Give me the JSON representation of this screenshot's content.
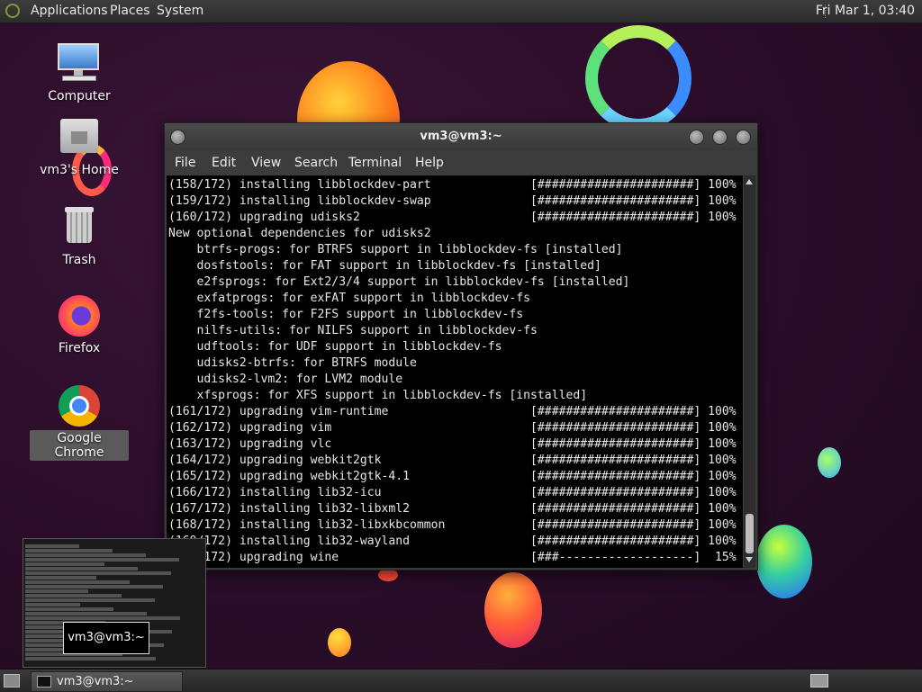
{
  "top_panel": {
    "menus": [
      "Applications",
      "Places",
      "System"
    ],
    "clock": "Fri Mar  1, 03:40"
  },
  "desktop_icons": [
    {
      "label": "Computer",
      "icon": "computer-icon"
    },
    {
      "label": "vm3's Home",
      "icon": "home-folder-icon"
    },
    {
      "label": "Trash",
      "icon": "trash-icon"
    },
    {
      "label": "Firefox",
      "icon": "firefox-icon"
    },
    {
      "label": "Google Chrome",
      "icon": "chrome-icon"
    }
  ],
  "terminal": {
    "title": "vm3@vm3:~",
    "menu": [
      "File",
      "Edit",
      "View",
      "Search",
      "Terminal",
      "Help"
    ],
    "lines": [
      "(158/172) installing libblockdev-part              [######################] 100%",
      "(159/172) installing libblockdev-swap              [######################] 100%",
      "(160/172) upgrading udisks2                        [######################] 100%",
      "New optional dependencies for udisks2",
      "    btrfs-progs: for BTRFS support in libblockdev-fs [installed]",
      "    dosfstools: for FAT support in libblockdev-fs [installed]",
      "    e2fsprogs: for Ext2/3/4 support in libblockdev-fs [installed]",
      "    exfatprogs: for exFAT support in libblockdev-fs",
      "    f2fs-tools: for F2FS support in libblockdev-fs",
      "    nilfs-utils: for NILFS support in libblockdev-fs",
      "    udftools: for UDF support in libblockdev-fs",
      "    udisks2-btrfs: for BTRFS module",
      "    udisks2-lvm2: for LVM2 module",
      "    xfsprogs: for XFS support in libblockdev-fs [installed]",
      "(161/172) upgrading vim-runtime                    [######################] 100%",
      "(162/172) upgrading vim                            [######################] 100%",
      "(163/172) upgrading vlc                            [######################] 100%",
      "(164/172) upgrading webkit2gtk                     [######################] 100%",
      "(165/172) upgrading webkit2gtk-4.1                 [######################] 100%",
      "(166/172) installing lib32-icu                     [######################] 100%",
      "(167/172) installing lib32-libxml2                 [######################] 100%",
      "(168/172) installing lib32-libxkbcommon            [######################] 100%",
      "(169/172) installing lib32-wayland                 [######################] 100%",
      "(170/172) upgrading wine                           [###-------------------]  15%"
    ]
  },
  "preview": {
    "tooltip": "vm3@vm3:~"
  },
  "taskbar": {
    "item_label": "vm3@vm3:~"
  }
}
